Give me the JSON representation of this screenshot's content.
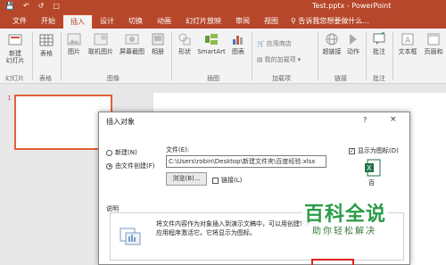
{
  "title_bar": {
    "title": "Test.pptx - PowerPoint",
    "qat": [
      "save-icon",
      "undo-icon",
      "redo-icon",
      "start-icon"
    ]
  },
  "tabs": [
    "文件",
    "开始",
    "插入",
    "设计",
    "切换",
    "动画",
    "幻灯片放映",
    "审阅",
    "视图"
  ],
  "active_tab": "插入",
  "tell_me": "告诉我您想要做什么...",
  "ribbon": {
    "new_slide": "新建\n幻灯片",
    "table": "表格",
    "picture": "图片",
    "online_picture": "联机图片",
    "screenshot": "屏幕截图",
    "album": "相册",
    "shapes": "形状",
    "smartart": "SmartArt",
    "chart": "图表",
    "store": "应用商店",
    "my_addins": "我的加载项",
    "link": "超链接",
    "action": "动作",
    "comment": "批注",
    "textbox": "文本框",
    "header_footer": "页眉和",
    "groups": {
      "slides": "幻灯片",
      "tables": "表格",
      "images": "图像",
      "illustrations": "插图",
      "addins": "加载项",
      "links": "链接",
      "comments": "批注"
    }
  },
  "slide_panel": {
    "slide_number": "1"
  },
  "dialog": {
    "title": "插入对象",
    "help": "?",
    "close": "×",
    "option_new": "新建(N)",
    "option_from_file": "由文件创建(F)",
    "file_label": "文件(E):",
    "file_value": "C:\\Users\\robin\\Desktop\\新建文件夹\\百度经验.xlsx",
    "browse": "浏览(B)...",
    "link": "链接(L)",
    "display_as_icon": "显示为图标(D)",
    "icon_caption": "百",
    "explain_label": "说明",
    "explain_text": "将文件内容作为对象插入到演示文稿中，可以用创建它的应用程序激活它。它将显示为图标。"
  },
  "watermark": {
    "title": "百科全说",
    "subtitle": "助你轻松解决"
  },
  "colors": {
    "accent": "#b7472a",
    "highlight": "#e02020",
    "watermark": "#2a9c49"
  }
}
